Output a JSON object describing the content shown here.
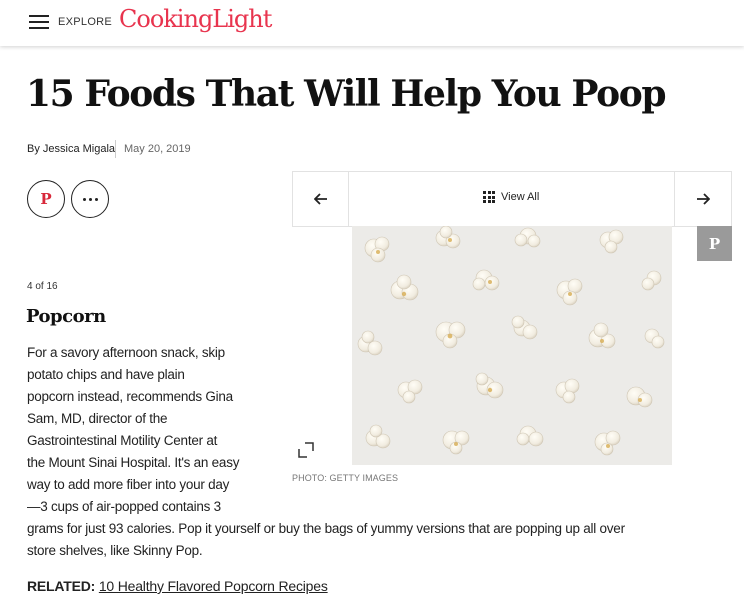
{
  "header": {
    "explore_label": "EXPLORE",
    "logo": "CookingLight",
    "logo_color": "#e8344e"
  },
  "article": {
    "title": "15 Foods That Will Help You Poop",
    "byline_prefix": "By",
    "author": "Jessica Migala",
    "date": "May 20, 2019"
  },
  "share": {
    "pinterest_icon": "pinterest-icon",
    "more_icon": "more-options-icon"
  },
  "slideshow": {
    "view_all_label": "View All",
    "counter": "4 of 16",
    "photo_credit": "PHOTO: GETTY IMAGES",
    "slide_title": "Popcorn",
    "body_lines": [
      "For a savory afternoon snack, skip",
      "potato chips and have plain",
      "popcorn instead, recommends Gina",
      "Sam, MD, director of the",
      "Gastrointestinal Motility Center at",
      "the Mount Sinai Hospital. It's an easy",
      "way to add more fiber into your day",
      "—3 cups of air-popped contains 3"
    ],
    "body_full_lines": [
      "grams for just 93 calories. Pop it yourself or buy the bags of yummy versions that are popping up all over",
      "store shelves, like Skinny Pop."
    ]
  },
  "related": {
    "label": "RELATED:",
    "link_text": "10 Healthy Flavored Popcorn Recipes"
  }
}
